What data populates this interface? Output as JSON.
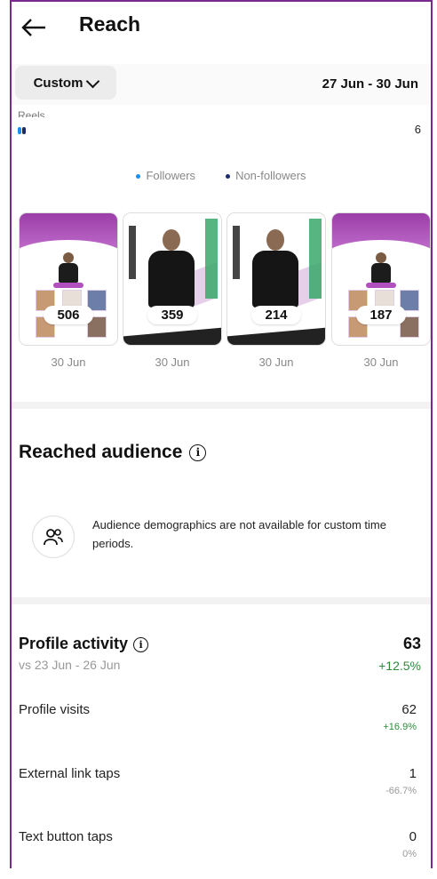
{
  "header": {
    "title": "Reach"
  },
  "filter": {
    "period_label": "Custom",
    "date_range": "27 Jun - 30 Jun"
  },
  "breakdown_row": {
    "label": "Reels",
    "value": "6"
  },
  "legend": {
    "followers": "Followers",
    "non_followers": "Non-followers"
  },
  "colors": {
    "followers": "#1c8ef0",
    "non_followers": "#1b2a6b",
    "positive": "#2e8b3a",
    "accent": "#7a2a8c"
  },
  "content": [
    {
      "count": "506",
      "date": "30 Jun"
    },
    {
      "count": "359",
      "date": "30 Jun"
    },
    {
      "count": "214",
      "date": "30 Jun"
    },
    {
      "count": "187",
      "date": "30 Jun"
    }
  ],
  "audience": {
    "title": "Reached audience",
    "message": "Audience demographics are not available for custom time periods."
  },
  "profile_activity": {
    "title": "Profile activity",
    "compare": "vs 23 Jun - 26 Jun",
    "value": "63",
    "change": "+12.5%",
    "metrics": [
      {
        "label": "Profile visits",
        "value": "62",
        "change": "+16.9%"
      },
      {
        "label": "External link taps",
        "value": "1",
        "change": "-66.7%"
      },
      {
        "label": "Text button taps",
        "value": "0",
        "change": "0%"
      }
    ]
  }
}
